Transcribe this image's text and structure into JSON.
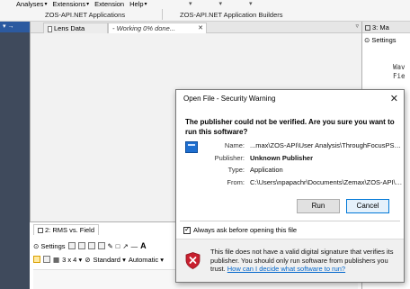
{
  "ribbon": {
    "menus": [
      {
        "label": "Analyses",
        "has_caret": true
      },
      {
        "label": "Extensions",
        "has_caret": true
      },
      {
        "label": "Extension",
        "has_caret": false
      },
      {
        "label": "Help",
        "has_caret": true
      }
    ],
    "groups": [
      "ZOS-API.NET Applications",
      "ZOS-API.NET Application Builders"
    ]
  },
  "left_strip": {
    "pin_label": "▾ →"
  },
  "document": {
    "tabs": [
      {
        "label": "Lens Data"
      },
      {
        "label": "- Working 0% done..."
      }
    ],
    "tab_close": "✕",
    "tab_dropdown": "▿"
  },
  "right_panel": {
    "tab_label": "3: Ma",
    "settings_label": "Settings",
    "lines": [
      "Wav",
      "Fie"
    ]
  },
  "bottom_panel": {
    "tab_label": "2: RMS vs. Field",
    "toolbar1": {
      "settings_label": "Settings",
      "text_tool_label": "A"
    },
    "toolbar2": {
      "layout_label": "3 x 4",
      "standard_label": "Standard",
      "automatic_label": "Automatic"
    }
  },
  "dialog": {
    "title": "Open File - Security Warning",
    "close_glyph": "✕",
    "warning": "The publisher could not be verified.  Are you sure you want to run this software?",
    "fields": [
      {
        "label": "Name:",
        "value": "...max\\ZOS-API\\User Analysis\\ThroughFocusPSF.exe",
        "bold": false
      },
      {
        "label": "Publisher:",
        "value": "Unknown Publisher",
        "bold": true
      },
      {
        "label": "Type:",
        "value": "Application",
        "bold": false
      },
      {
        "label": "From:",
        "value": "C:\\Users\\npapachr\\Documents\\Zemax\\ZOS-API\\U...",
        "bold": false
      }
    ],
    "run_label": "Run",
    "cancel_label": "Cancel",
    "checkbox_label": "Always ask before opening this file",
    "checkbox_checked": true,
    "footer_text": "This file does not have a valid digital signature that verifies its publisher.  You should only run software from publishers you trust.",
    "footer_link": "How can I decide what software to run?"
  },
  "colors": {
    "accent_blue": "#0078d7",
    "link_blue": "#0066cc",
    "shield_red": "#c8202f",
    "left_strip": "#3f4a5c"
  }
}
